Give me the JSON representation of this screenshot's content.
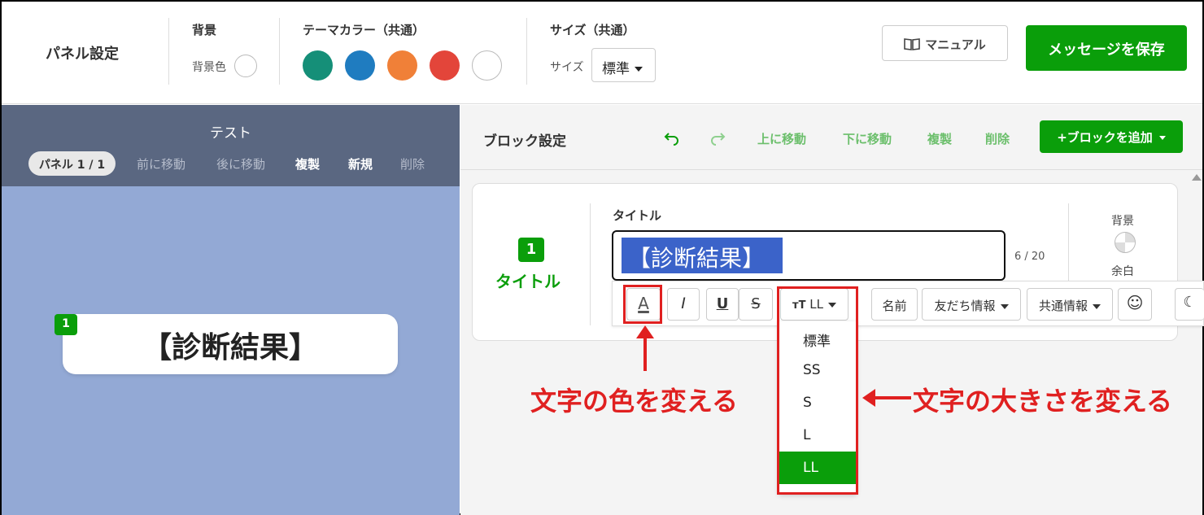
{
  "topbar": {
    "panel_settings": "パネル設定",
    "bg_section": "背景",
    "bg_color_label": "背景色",
    "theme_section": "テーマカラー（共通）",
    "theme_colors": [
      "#158f78",
      "#1f7cc0",
      "#f08038",
      "#e3453a",
      "#ffffff"
    ],
    "size_section": "サイズ（共通）",
    "size_label": "サイズ",
    "size_value": "標準",
    "manual_label": "マニュアル",
    "save_label": "メッセージを保存"
  },
  "left": {
    "title": "テスト",
    "panel_pill": "パネル 1 / 1",
    "nav": [
      "前に移動",
      "後に移動",
      "複製",
      "新規",
      "削除"
    ],
    "bubble_badge": "1",
    "bubble_text": "【診断結果】"
  },
  "right": {
    "header_title": "ブロック設定",
    "move_up": "上に移動",
    "move_down": "下に移動",
    "duplicate": "複製",
    "delete": "削除",
    "add_block": "+ブロックを追加",
    "block_badge": "1",
    "block_name": "タイトル",
    "field_label": "タイトル",
    "field_value": "【診断結果】",
    "char_count": "6 / 20",
    "bg_label": "背景",
    "margin_label": "余白"
  },
  "toolbar": {
    "font_size_value": "LL",
    "name_btn": "名前",
    "friend_info": "友だち情報",
    "common_info": "共通情報"
  },
  "size_dropdown": {
    "options": [
      "標準",
      "SS",
      "S",
      "L",
      "LL"
    ],
    "selected": "LL"
  },
  "annotations": {
    "color_note": "文字の色を変える",
    "size_note": "文字の大きさを変える"
  },
  "colors": {
    "accent": "#0a9e0a",
    "annotation": "#e02020"
  }
}
